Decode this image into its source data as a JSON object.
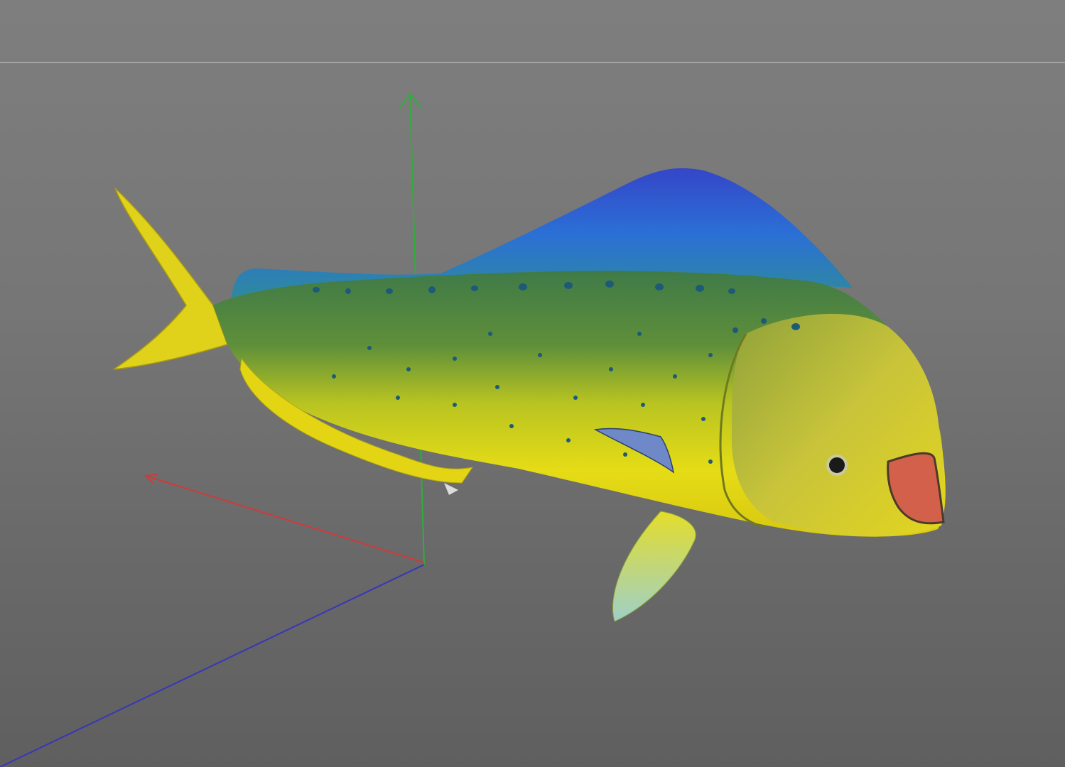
{
  "viewport": {
    "background_top": "#7e7e7e",
    "background_bottom": "#5f5f5f",
    "horizon_color": "#a3a3a3"
  },
  "axes": {
    "x_color": "#d03a3a",
    "y_color": "#2fae3a",
    "z_color": "#3737b8"
  },
  "model": {
    "object": "fish-model",
    "colors": {
      "dorsal_fin": "#2a5fd0",
      "back": "#4f8a3a",
      "belly": "#e4dc18",
      "tail": "#e0d21a",
      "spots": "#1d5a78",
      "mouth": "#d2604a"
    }
  }
}
